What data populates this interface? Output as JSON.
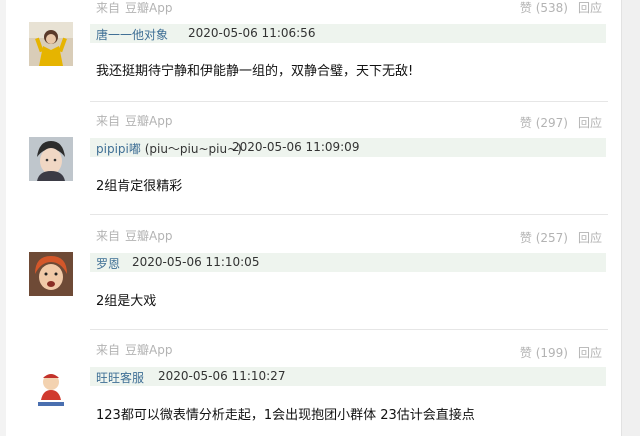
{
  "comments": [
    {
      "source_prefix": "来自",
      "source_app": "豆瓣App",
      "like_label": "赞",
      "like_count": "(538)",
      "reply_label": "回应",
      "author": "唐一一他对象",
      "author_suffix": "",
      "time": "2020-05-06 11:06:56",
      "text": "我还挺期待宁静和伊能静一组的，双静合璧，天下无敌!"
    },
    {
      "source_prefix": "来自",
      "source_app": "豆瓣App",
      "like_label": "赞",
      "like_count": "(297)",
      "reply_label": "回应",
      "author": "pipipi嘟",
      "author_suffix": "(piu～piu~piu~)",
      "time": "2020-05-06 11:09:09",
      "text": "2组肯定很精彩"
    },
    {
      "source_prefix": "来自",
      "source_app": "豆瓣App",
      "like_label": "赞",
      "like_count": "(257)",
      "reply_label": "回应",
      "author": "罗恩",
      "author_suffix": "",
      "time": "2020-05-06 11:10:05",
      "text": "2组是大戏"
    },
    {
      "source_prefix": "来自",
      "source_app": "豆瓣App",
      "like_label": "赞",
      "like_count": "(199)",
      "reply_label": "回应",
      "author": "旺旺客服",
      "author_suffix": "",
      "time": "2020-05-06 11:10:27",
      "text": "123都可以微表情分析走起，1会出现抱团小群体 23估计会直接点"
    }
  ],
  "colors": {
    "author_link": "#3f6f95",
    "meta_gray": "#b3b3b3",
    "bar_bg": "#eef4ee"
  }
}
